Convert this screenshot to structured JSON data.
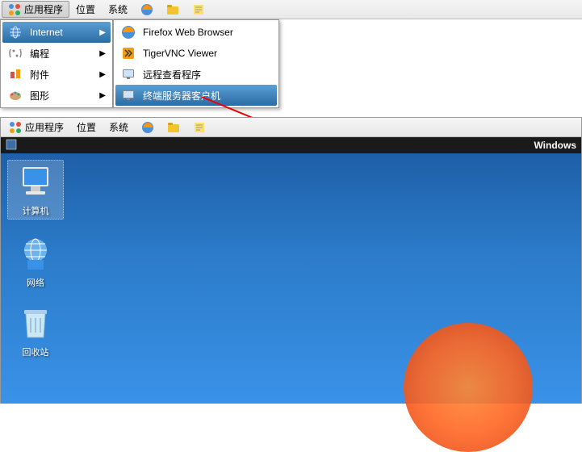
{
  "top_menubar": {
    "applications": "应用程序",
    "location": "位置",
    "system": "系统"
  },
  "dropdown": {
    "internet": "Internet",
    "programming": "编程",
    "accessories": "附件",
    "graphics": "图形"
  },
  "submenu": {
    "firefox": "Firefox Web Browser",
    "tigervnc": "TigerVNC Viewer",
    "remote_viewer": "远程查看程序",
    "terminal_server": "终端服务器客户机"
  },
  "desktop_menubar": {
    "applications": "应用程序",
    "location": "位置",
    "system": "系统"
  },
  "taskbar": {
    "title": "Windows"
  },
  "desktop_icons": {
    "computer": "计算机",
    "network": "网络",
    "recycle": "回收站"
  }
}
